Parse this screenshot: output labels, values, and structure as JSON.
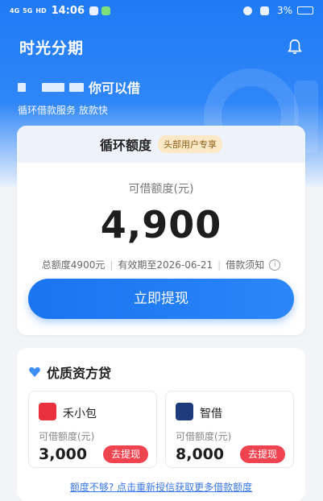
{
  "status_bar": {
    "signal_1": "4G",
    "signal_2": "5G",
    "hd": "HD",
    "time": "14:06",
    "battery": "3%"
  },
  "app": {
    "title": "时光分期",
    "bell_icon": "bell-icon"
  },
  "greeting": {
    "masked_name_suffix": "你可以借",
    "subtitle": "循环借款服务 放款快"
  },
  "credit_card": {
    "header_title": "循环额度",
    "header_tag": "头部用户专享",
    "available_label": "可借额度(元)",
    "available_amount": "4,900",
    "total_text": "总额度4900元",
    "validity_text": "有效期至2026-06-21",
    "notice_text": "借款须知",
    "info_icon": "i",
    "withdraw_button": "立即提现"
  },
  "quality_section": {
    "title": "优质资方贷",
    "products": [
      {
        "name": "禾小包",
        "limit_label": "可借额度(元)",
        "amount": "3,000",
        "button": "去提现",
        "logo_color": "#e8313d"
      },
      {
        "name": "智借",
        "limit_label": "可借额度(元)",
        "amount": "8,000",
        "button": "去提现",
        "logo_color": "#1d3a7a"
      }
    ],
    "more_link": "额度不够? 点击重新授信获取更多借款额度"
  },
  "colors": {
    "primary": "#1f7af5",
    "danger": "#ef4450",
    "tag_bg": "#fde9c7"
  }
}
